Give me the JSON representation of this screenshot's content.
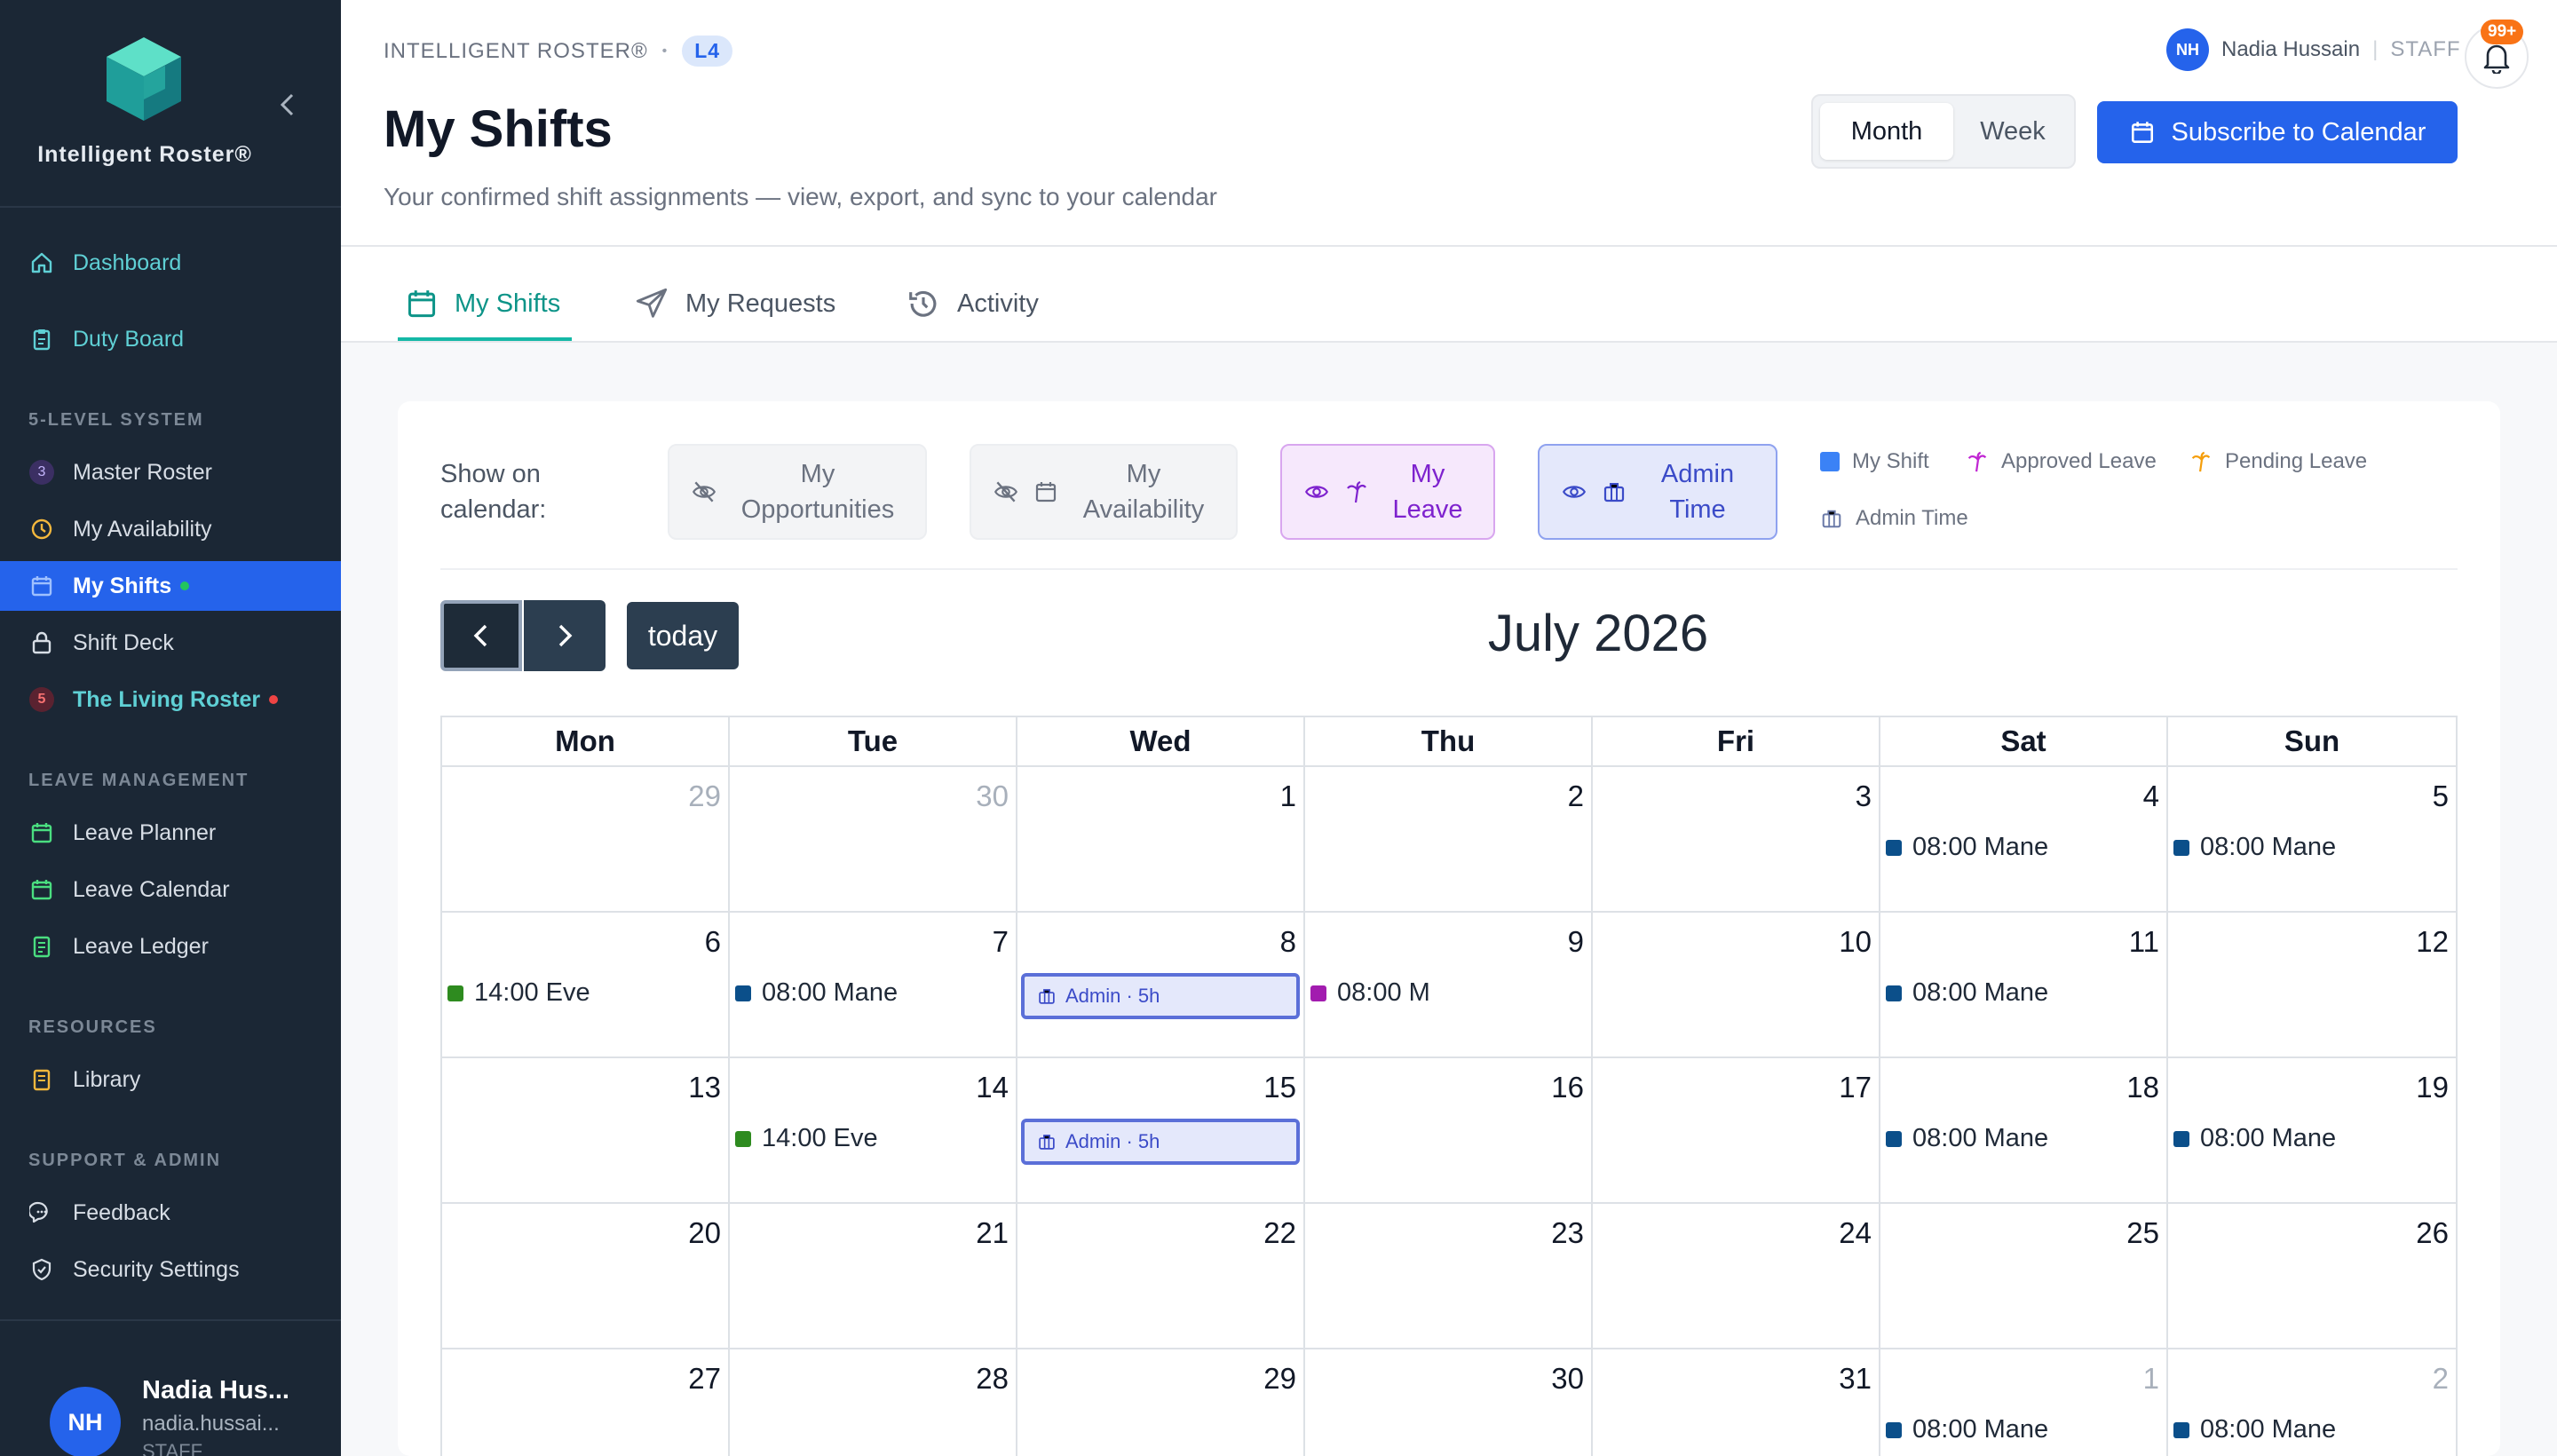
{
  "app": {
    "name": "Intelligent Roster®",
    "collapse_label": "‹"
  },
  "sidebar": {
    "items_top": [
      {
        "label": "Dashboard",
        "icon": "home-icon"
      },
      {
        "label": "Duty Board",
        "icon": "clipboard-icon"
      }
    ],
    "section_5level": "5-LEVEL SYSTEM",
    "items_5level": [
      {
        "label": "Master Roster",
        "badge": "3"
      },
      {
        "label": "My Availability"
      },
      {
        "label": "My Shifts"
      },
      {
        "label": "Shift Deck"
      },
      {
        "label": "The Living Roster",
        "badge": "5"
      }
    ],
    "section_leave": "LEAVE MANAGEMENT",
    "items_leave": [
      {
        "label": "Leave Planner"
      },
      {
        "label": "Leave Calendar"
      },
      {
        "label": "Leave Ledger"
      }
    ],
    "section_resources": "RESOURCES",
    "items_resources": [
      {
        "label": "Library"
      }
    ],
    "section_support": "SUPPORT & ADMIN",
    "items_support": [
      {
        "label": "Feedback"
      },
      {
        "label": "Security Settings"
      }
    ],
    "user": {
      "initials": "NH",
      "name": "Nadia Hus...",
      "email": "nadia.hussai...",
      "role": "STAFF"
    }
  },
  "header": {
    "breadcrumb": "INTELLIGENT ROSTER®",
    "breadcrumb_sep": "•",
    "level": "L4",
    "title": "My Shifts",
    "subtitle": "Your confirmed shift assignments — view, export, and sync to your calendar",
    "user_initials": "NH",
    "user_name": "Nadia Hussain",
    "user_sep": "|",
    "user_role": "STAFF",
    "notifications": "99+",
    "view_month": "Month",
    "view_week": "Week",
    "subscribe": "Subscribe to Calendar"
  },
  "tabs": [
    {
      "label": "My Shifts",
      "active": true
    },
    {
      "label": "My Requests"
    },
    {
      "label": "Activity"
    }
  ],
  "filters": {
    "label_1": "Show on",
    "label_2": "calendar:",
    "opportunities_1": "My",
    "opportunities_2": "Opportunities",
    "availability_1": "My",
    "availability_2": "Availability",
    "leave_1": "My",
    "leave_2": "Leave",
    "admin_1": "Admin",
    "admin_2": "Time"
  },
  "legend": {
    "my_shift": "My Shift",
    "approved_leave": "Approved Leave",
    "pending_leave": "Pending Leave",
    "admin_time": "Admin Time"
  },
  "calendar": {
    "title": "July 2026",
    "today": "today",
    "weekdays": [
      "Mon",
      "Tue",
      "Wed",
      "Thu",
      "Fri",
      "Sat",
      "Sun"
    ],
    "weeks": [
      [
        "29",
        "30",
        "1",
        "2",
        "3",
        "4",
        "5"
      ],
      [
        "6",
        "7",
        "8",
        "9",
        "10",
        "11",
        "12"
      ],
      [
        "13",
        "14",
        "15",
        "16",
        "17",
        "18",
        "19"
      ],
      [
        "20",
        "21",
        "22",
        "23",
        "24",
        "25",
        "26"
      ],
      [
        "27",
        "28",
        "29",
        "30",
        "31",
        "1",
        "2"
      ]
    ],
    "events": {
      "mane": "08:00 Mane",
      "eve": "14:00 Eve",
      "m": "08:00 M",
      "admin": "Admin · 5h"
    }
  },
  "colors": {
    "accent": "#2563eb",
    "teal": "#14b8a6",
    "mane": "#0b4f8a",
    "eve": "#2e8b1f",
    "m": "#a21caf",
    "sidebar_bg": "#1b2735"
  }
}
